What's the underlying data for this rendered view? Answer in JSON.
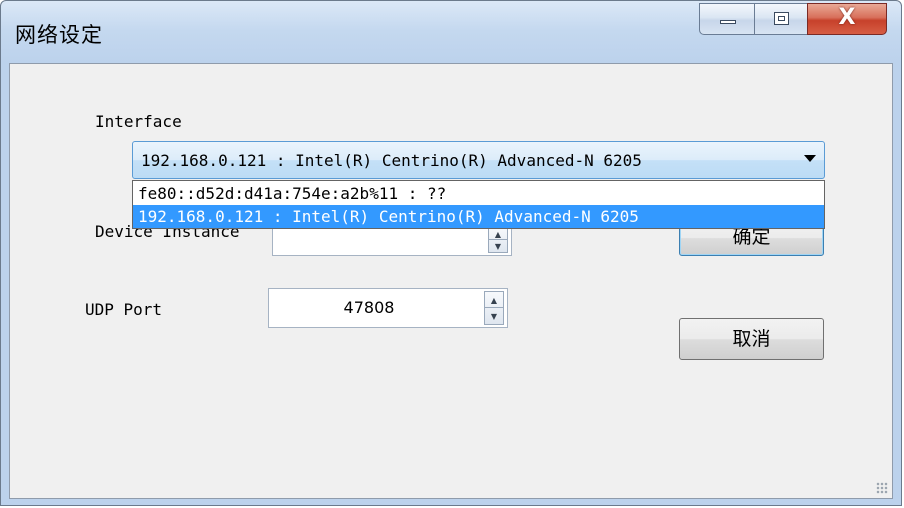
{
  "window": {
    "title": "网络设定",
    "close_label": "X"
  },
  "form": {
    "interface_label": "Interface",
    "interface_selected": "192.168.0.121 : Intel(R) Centrino(R) Advanced-N 6205",
    "interface_options": [
      "fe80::d52d:d41a:754e:a2b%11 : ??",
      "192.168.0.121 : Intel(R) Centrino(R) Advanced-N 6205"
    ],
    "device_instance_label": "Device Instance",
    "device_instance_value": "",
    "udp_port_label": "UDP Port",
    "udp_port_value": "47808"
  },
  "buttons": {
    "ok_label": "确定",
    "cancel_label": "取消"
  }
}
